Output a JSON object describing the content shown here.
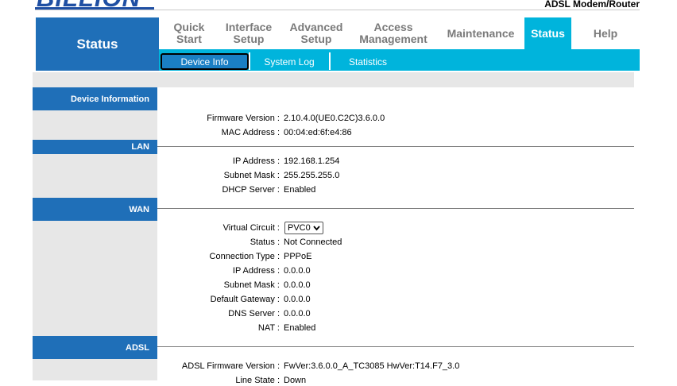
{
  "brand": {
    "logo_text": "BILLION",
    "product": "ADSL Modem/Router"
  },
  "nav": {
    "section_title": "Status",
    "items": [
      {
        "line1": "Quick",
        "line2": "Start"
      },
      {
        "line1": "Interface",
        "line2": "Setup"
      },
      {
        "line1": "Advanced",
        "line2": "Setup"
      },
      {
        "line1": "Access",
        "line2": "Management"
      },
      {
        "line1": "Maintenance",
        "line2": ""
      }
    ],
    "active": "Status",
    "help": "Help"
  },
  "subnav": {
    "items": [
      "Device Info",
      "System Log",
      "Statistics"
    ],
    "active": "Device Info"
  },
  "device_info": {
    "heading": "Device Information",
    "firmware_label": "Firmware Version :",
    "firmware_value": "2.10.4.0(UE0.C2C)3.6.0.0",
    "mac_label": "MAC Address :",
    "mac_value": "00:04:ed:6f:e4:86"
  },
  "lan": {
    "heading": "LAN",
    "ip_label": "IP Address :",
    "ip_value": "192.168.1.254",
    "mask_label": "Subnet Mask :",
    "mask_value": "255.255.255.0",
    "dhcp_label": "DHCP Server :",
    "dhcp_value": "Enabled"
  },
  "wan": {
    "heading": "WAN",
    "vc_label": "Virtual Circuit :",
    "vc_value": "PVC0",
    "status_label": "Status :",
    "status_value": "Not Connected",
    "conn_label": "Connection Type :",
    "conn_value": "PPPoE",
    "ip_label": "IP Address :",
    "ip_value": "0.0.0.0",
    "mask_label": "Subnet Mask :",
    "mask_value": "0.0.0.0",
    "gw_label": "Default Gateway :",
    "gw_value": "0.0.0.0",
    "dns_label": "DNS Server :",
    "dns_value": "0.0.0.0",
    "nat_label": "NAT :",
    "nat_value": "Enabled"
  },
  "adsl": {
    "heading": "ADSL",
    "fw_label": "ADSL Firmware Version :",
    "fw_value": "FwVer:3.6.0.0_A_TC3085 HwVer:T14.F7_3.0",
    "line_label": "Line State :",
    "line_value": "Down"
  }
}
